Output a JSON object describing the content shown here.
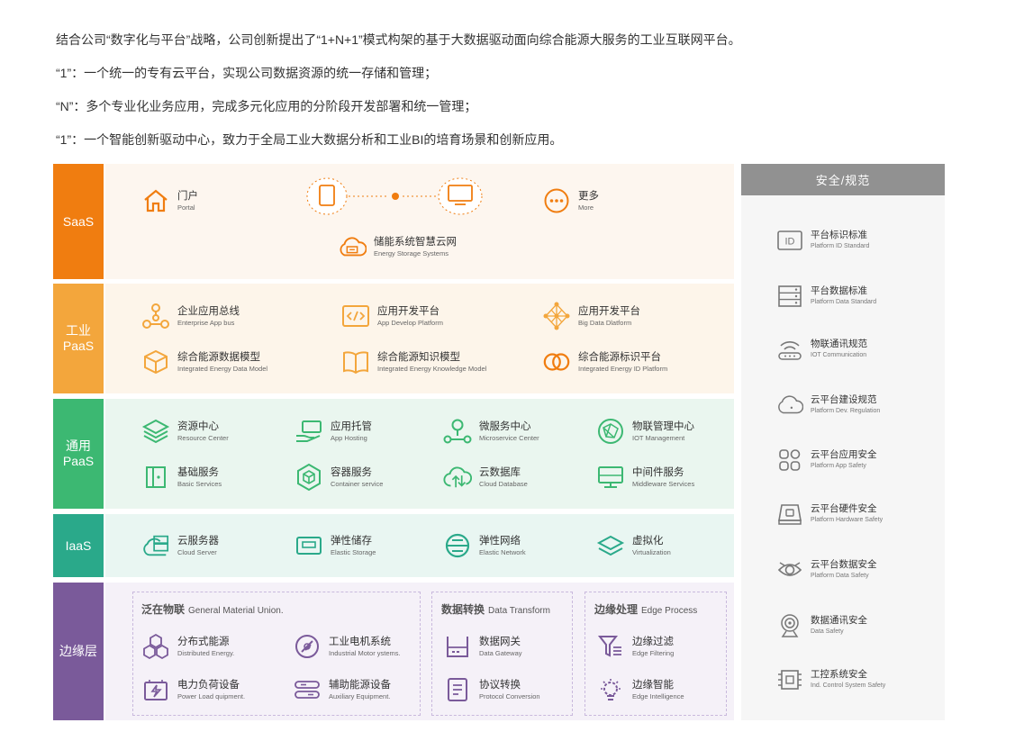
{
  "intro": {
    "line1": "结合公司“数字化与平台”战略，公司创新提出了“1+N+1”模式构架的基于大数据驱动面向综合能源大服务的工业互联网平台。",
    "line2": "“1”：一个统一的专有云平台，实现公司数据资源的统一存储和管理；",
    "line3": "“N”：多个专业化业务应用，完成多元化应用的分阶段开发部署和统一管理；",
    "line4": "“1”：一个智能创新驱动中心，致力于全局工业大数据分析和工业BI的培育场景和创新应用。"
  },
  "colors": {
    "saas": "#f07d10",
    "ipaas": "#f3a63c",
    "gpaas": "#3cb872",
    "iaas": "#2aa98a",
    "edge": "#7a5a9a",
    "saas_bg": "#fdf6ef",
    "ipaas_bg": "#fdf5ea",
    "gpaas_bg": "#eaf6ef",
    "iaas_bg": "#e9f6f2",
    "edge_bg": "#f5f1f8"
  },
  "layers": {
    "saas": {
      "label": "SaaS",
      "items": [
        {
          "zh": "门户",
          "en": "Portal",
          "icon": "house-icon"
        },
        {
          "zh": "更多",
          "en": "More",
          "icon": "more-icon"
        },
        {
          "zh": "储能系统智慧云网",
          "en": "Energy Storage Systems",
          "icon": "battery-cloud-icon"
        }
      ]
    },
    "ipaas": {
      "label": "工业\nPaaS",
      "items": [
        {
          "zh": "企业应用总线",
          "en": "Enterprise App bus",
          "icon": "bus-icon"
        },
        {
          "zh": "应用开发平台",
          "en": "App Develop Platform",
          "icon": "code-icon"
        },
        {
          "zh": "应用开发平台",
          "en": "Big Data Dlatform",
          "icon": "network-icon"
        },
        {
          "zh": "综合能源数据模型",
          "en": "Integrated Energy Data Model",
          "icon": "cube-icon"
        },
        {
          "zh": "综合能源知识模型",
          "en": "Integrated Energy Knowledge Model",
          "icon": "book-icon"
        },
        {
          "zh": "综合能源标识平台",
          "en": "Integrated Energy ID Platform",
          "icon": "id-rings-icon"
        }
      ]
    },
    "gpaas": {
      "label": "通用\nPaaS",
      "items": [
        {
          "zh": "资源中心",
          "en": "Resource Center",
          "icon": "layers-icon"
        },
        {
          "zh": "应用托管",
          "en": "App Hosting",
          "icon": "hand-icon"
        },
        {
          "zh": "微服务中心",
          "en": "Microservice Center",
          "icon": "micro-icon"
        },
        {
          "zh": "物联管理中心",
          "en": "IOT Management",
          "icon": "iot-icon"
        },
        {
          "zh": "基础服务",
          "en": "Basic Services",
          "icon": "door-icon"
        },
        {
          "zh": "容器服务",
          "en": "Container service",
          "icon": "container-icon"
        },
        {
          "zh": "云数据库",
          "en": "Cloud Database",
          "icon": "cloud-db-icon"
        },
        {
          "zh": "中间件服务",
          "en": "Middleware Services",
          "icon": "monitor-icon"
        }
      ]
    },
    "iaas": {
      "label": "IaaS",
      "items": [
        {
          "zh": "云服务器",
          "en": "Cloud Server",
          "icon": "cloud-server-icon"
        },
        {
          "zh": "弹性储存",
          "en": "Elastic Storage",
          "icon": "storage-icon"
        },
        {
          "zh": "弹性网络",
          "en": "Elastic Network",
          "icon": "globe-icon"
        },
        {
          "zh": "虚拟化",
          "en": "Virtualization",
          "icon": "virtual-icon"
        }
      ]
    },
    "edge": {
      "label": "边缘层",
      "sections": [
        {
          "title": "泛在物联",
          "sub": "General Material Union."
        },
        {
          "title": "数据转换",
          "sub": "Data Transform"
        },
        {
          "title": "边缘处理",
          "sub": "Edge Process"
        }
      ],
      "items": [
        {
          "zh": "分布式能源",
          "en": "Distributed Energy.",
          "icon": "hex-icon"
        },
        {
          "zh": "工业电机系统",
          "en": "Industrial Motor ystems.",
          "icon": "motor-icon"
        },
        {
          "zh": "电力负荷设备",
          "en": "Power Load quipment.",
          "icon": "power-icon"
        },
        {
          "zh": "辅助能源设备",
          "en": "Auxiliary Equipment.",
          "icon": "aux-icon"
        },
        {
          "zh": "数据网关",
          "en": "Data Gateway",
          "icon": "gateway-icon"
        },
        {
          "zh": "协议转换",
          "en": "Protocol Conversion",
          "icon": "doc-icon"
        },
        {
          "zh": "边缘过滤",
          "en": "Edge Filtering",
          "icon": "filter-icon"
        },
        {
          "zh": "边缘智能",
          "en": "Edge Intelligence",
          "icon": "bulb-icon"
        }
      ]
    }
  },
  "security": {
    "title": "安全/规范",
    "items": [
      {
        "zh": "平台标识标准",
        "en": "Platform ID Standard",
        "icon": "id-icon"
      },
      {
        "zh": "平台数据标准",
        "en": "Platform Data Standard",
        "icon": "server-icon"
      },
      {
        "zh": "物联通讯规范",
        "en": "IOT Communication",
        "icon": "wifi-icon"
      },
      {
        "zh": "云平台建设规范",
        "en": "Platform Dev. Regulation",
        "icon": "cloud-icon"
      },
      {
        "zh": "云平台应用安全",
        "en": "Platform App Safety",
        "icon": "apps-icon"
      },
      {
        "zh": "云平台硬件安全",
        "en": "Platform Hardware Safety",
        "icon": "hardware-icon"
      },
      {
        "zh": "云平台数据安全",
        "en": "Platform Data Safety",
        "icon": "eye-icon"
      },
      {
        "zh": "数据通讯安全",
        "en": "Data Safety",
        "icon": "signal-icon"
      },
      {
        "zh": "工控系统安全",
        "en": "Ind. Control System Safety",
        "icon": "chip-icon"
      }
    ]
  }
}
